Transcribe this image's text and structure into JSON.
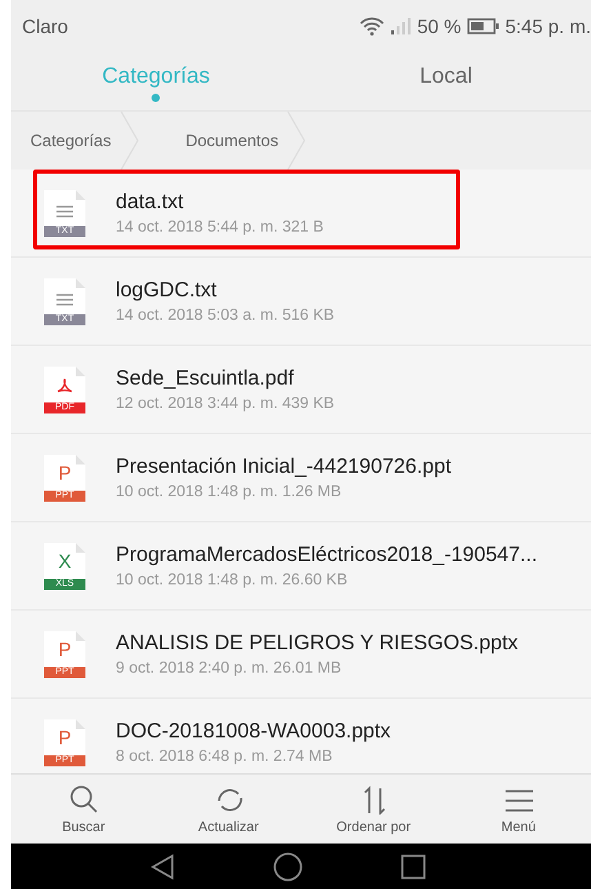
{
  "status_bar": {
    "carrier": "Claro",
    "battery": "50 %",
    "time": "5:45 p. m."
  },
  "tabs": [
    {
      "label": "Categorías",
      "selected": true
    },
    {
      "label": "Local",
      "selected": false
    }
  ],
  "breadcrumb": [
    "Categorías",
    "Documentos"
  ],
  "files": [
    {
      "name": "data.txt",
      "meta": "14 oct. 2018 5:44 p. m. 321 B",
      "kind": "txt",
      "badge": "TXT",
      "highlighted": true
    },
    {
      "name": "logGDC.txt",
      "meta": "14 oct. 2018 5:03 a. m. 516 KB",
      "kind": "txt",
      "badge": "TXT",
      "highlighted": false
    },
    {
      "name": "Sede_Escuintla.pdf",
      "meta": "12 oct. 2018 3:44 p. m. 439 KB",
      "kind": "pdf",
      "badge": "PDF",
      "highlighted": false
    },
    {
      "name": "Presentación Inicial_-442190726.ppt",
      "meta": "10 oct. 2018 1:48 p. m. 1.26 MB",
      "kind": "ppt",
      "badge": "PPT",
      "glyph": "P",
      "highlighted": false
    },
    {
      "name": "ProgramaMercadosEléctricos2018_-190547...",
      "meta": "10 oct. 2018 1:48 p. m. 26.60 KB",
      "kind": "xls",
      "badge": "XLS",
      "glyph": "X",
      "highlighted": false
    },
    {
      "name": "ANALISIS DE PELIGROS Y RIESGOS.pptx",
      "meta": "9 oct. 2018 2:40 p. m. 26.01 MB",
      "kind": "ppt",
      "badge": "PPT",
      "glyph": "P",
      "highlighted": false
    },
    {
      "name": "DOC-20181008-WA0003.pptx",
      "meta": "8 oct. 2018 6:48 p. m. 2.74 MB",
      "kind": "ppt",
      "badge": "PPT",
      "glyph": "P",
      "highlighted": false
    }
  ],
  "toolbar": [
    {
      "label": "Buscar",
      "kind": "search"
    },
    {
      "label": "Actualizar",
      "kind": "refresh"
    },
    {
      "label": "Ordenar por",
      "kind": "sort"
    },
    {
      "label": "Menú",
      "kind": "menu"
    }
  ]
}
